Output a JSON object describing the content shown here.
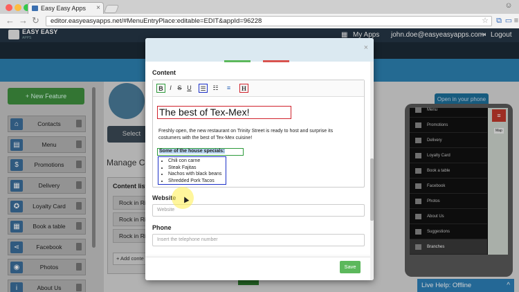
{
  "browser": {
    "tab_title": "Easy Easy Apps Editor",
    "tab_close": "×",
    "url": "editor.easyeasyapps.net/#MenuEntryPlace:editable=EDIT&appId=96228",
    "icons": [
      "back-arrow-icon",
      "forward-arrow-icon",
      "reload-icon",
      "star-icon",
      "extension-icon",
      "cast-icon",
      "menu-icon",
      "person-icon"
    ]
  },
  "app_header": {
    "logo_text": "EASY EASY",
    "logo_sub": "APPS",
    "my_apps": "My Apps",
    "user_email": "john.doe@easyeasyapps.com",
    "logout": "Logout"
  },
  "sidebar": {
    "new_feature": "+ New Feature",
    "items": [
      {
        "label": "Contacts",
        "icon": "house-icon"
      },
      {
        "label": "Menu",
        "icon": "book-icon"
      },
      {
        "label": "Promotions",
        "icon": "dollar-icon"
      },
      {
        "label": "Delivery",
        "icon": "clipboard-icon"
      },
      {
        "label": "Loyalty Card",
        "icon": "medal-icon"
      },
      {
        "label": "Book a table",
        "icon": "calendar-icon"
      },
      {
        "label": "Facebook",
        "icon": "share-icon"
      },
      {
        "label": "Photos",
        "icon": "camera-icon"
      },
      {
        "label": "About Us",
        "icon": "info-icon"
      }
    ]
  },
  "main": {
    "select_button": "Select",
    "manage_title": "Manage Co",
    "content_list_title": "Content list",
    "rows": [
      "Rock in Ri",
      "Rock in Ri",
      "Rock in Ri"
    ],
    "add_content": "+ Add conte"
  },
  "preview": {
    "open_phone": "Open in your phone",
    "menu_items": [
      "Menu",
      "Promotions",
      "Delivery",
      "Loyalty Card",
      "Book a table",
      "Facebook",
      "Photos",
      "About Us",
      "Suggestions",
      "Branches"
    ],
    "active_item": "Branches",
    "map_label": "Map"
  },
  "live_help": {
    "label": "Live Help: Offline",
    "chevron": "^"
  },
  "modal": {
    "close": "×",
    "content_label": "Content",
    "toolbar": {
      "bold": "B",
      "italic": "I",
      "strike": "S",
      "underline": "U",
      "bullet_list": "☰",
      "numbered_list": "☷",
      "align": "≡",
      "heading": "H"
    },
    "heading": "The best of Tex-Mex!",
    "paragraph": "Freshly open, the new restaurant on Trinity Street is ready to host and surprise its costumers with the best of Tex-Mex cuisine!",
    "specials_heading": "Some of the house specials:",
    "specials": [
      "Chili con carne",
      "Steak Fajitas",
      "Nachos with black beans",
      "Shredded Pork Tacos"
    ],
    "website_label": "Website",
    "website_placeholder": "Website",
    "phone_label": "Phone",
    "phone_placeholder": "Insert the telephone number",
    "save": "Save"
  }
}
